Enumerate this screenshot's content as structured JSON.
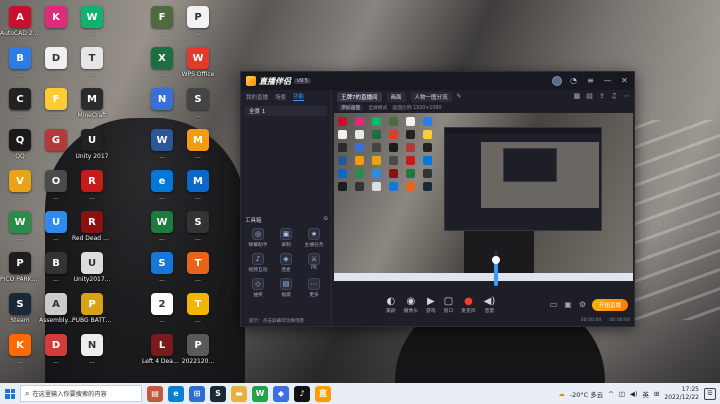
{
  "desktop_icons": [
    {
      "label": "AutoCAD 2014",
      "color": "#c8102e",
      "glyph": "A"
    },
    {
      "label": "...",
      "color": "#e02a7b",
      "glyph": "K"
    },
    {
      "label": "...",
      "color": "#10b36b",
      "glyph": "W"
    },
    {
      "label": "...",
      "color": "#4e6b3f",
      "glyph": "F"
    },
    {
      "label": "...",
      "color": "#f2f2f2",
      "glyph": "P"
    },
    {
      "label": "...",
      "color": "#2d7be5",
      "glyph": "B"
    },
    {
      "label": "...",
      "color": "#f0f0f0",
      "glyph": "D"
    },
    {
      "label": "...",
      "color": "#e6e6e6",
      "glyph": "T"
    },
    {
      "label": "...",
      "color": "#1d6f42",
      "glyph": "X"
    },
    {
      "label": "WPS Office",
      "color": "#e23a2c",
      "glyph": "W"
    },
    {
      "label": "...",
      "color": "#222222",
      "glyph": "C"
    },
    {
      "label": "...",
      "color": "#ffcc33",
      "glyph": "F"
    },
    {
      "label": "MineCraft",
      "color": "#2b2b2b",
      "glyph": "M"
    },
    {
      "label": "...",
      "color": "#3a6fd8",
      "glyph": "N"
    },
    {
      "label": "...",
      "color": "#444444",
      "glyph": "S"
    },
    {
      "label": "QQ",
      "color": "#1a1a1a",
      "glyph": "Q"
    },
    {
      "label": "...",
      "color": "#b33a3a",
      "glyph": "G"
    },
    {
      "label": "Unity 2017",
      "color": "#222222",
      "glyph": "U"
    },
    {
      "label": "...",
      "color": "#2b5797",
      "glyph": "W"
    },
    {
      "label": "...",
      "color": "#f39c12",
      "glyph": "M"
    },
    {
      "label": "...",
      "color": "#e8a317",
      "glyph": "V"
    },
    {
      "label": "...",
      "color": "#4a4a4a",
      "glyph": "O"
    },
    {
      "label": "...",
      "color": "#c61b1b",
      "glyph": "R"
    },
    {
      "label": "...",
      "color": "#0078d7",
      "glyph": "e"
    },
    {
      "label": "...",
      "color": "#0b68c9",
      "glyph": "M"
    },
    {
      "label": "...",
      "color": "#2a8c4a",
      "glyph": "W"
    },
    {
      "label": "...",
      "color": "#2d8ceb",
      "glyph": "U"
    },
    {
      "label": "Red Dead Redempti...",
      "color": "#8b1010",
      "glyph": "R"
    },
    {
      "label": "...",
      "color": "#1f7a3e",
      "glyph": "W"
    },
    {
      "label": "...",
      "color": "#333333",
      "glyph": "S"
    },
    {
      "label": "PICO PARKClass...",
      "color": "#1d1d1d",
      "glyph": "P"
    },
    {
      "label": "...",
      "color": "#333333",
      "glyph": "B"
    },
    {
      "label": "Unity2017...",
      "color": "#dddddd",
      "glyph": "U"
    },
    {
      "label": "...",
      "color": "#1677d8",
      "glyph": "S"
    },
    {
      "label": "...",
      "color": "#e8641b",
      "glyph": "T"
    },
    {
      "label": "Steam",
      "color": "#1b2838",
      "glyph": "S"
    },
    {
      "label": "Assembly...",
      "color": "#cccccc",
      "glyph": "A"
    },
    {
      "label": "PUBG BATTLEGR...",
      "color": "#d8a21b",
      "glyph": "P"
    },
    {
      "label": "...",
      "color": "#ffffff",
      "glyph": "2"
    },
    {
      "label": "...",
      "color": "#f2b600",
      "glyph": "T"
    },
    {
      "label": "...",
      "color": "#ff6a00",
      "glyph": "K"
    },
    {
      "label": "...",
      "color": "#d23b3b",
      "glyph": "D"
    },
    {
      "label": "...",
      "color": "#eeeeee",
      "glyph": "N"
    },
    {
      "label": "Left 4 Dead 2",
      "color": "#7a1a1a",
      "glyph": "L"
    },
    {
      "label": "2022120...",
      "color": "#5a5a5a",
      "glyph": "P"
    }
  ],
  "app": {
    "name": "直播伴侣",
    "version": "v9.5",
    "left_tabs": [
      "我的直播",
      "场景",
      "功能"
    ],
    "scene_item": "全景 1",
    "tools_title": "工具箱",
    "tools": [
      {
        "label": "弹幕助手",
        "glyph": "◎"
      },
      {
        "label": "录制",
        "glyph": "▣"
      },
      {
        "label": "主播任务",
        "glyph": "★"
      },
      {
        "label": "视频互动",
        "glyph": "♪"
      },
      {
        "label": "连麦",
        "glyph": "◈"
      },
      {
        "label": "PK",
        "glyph": "⚔"
      },
      {
        "label": "抽奖",
        "glyph": "◇"
      },
      {
        "label": "福袋",
        "glyph": "▤"
      },
      {
        "label": "更多",
        "glyph": "⋯"
      }
    ],
    "scene_tabs": [
      "王牌7的直播间",
      "画面",
      "人物一图分流"
    ],
    "sub_row": [
      "添加画面",
      "全屏模式",
      "画面比例 1920×1080"
    ],
    "controls": [
      {
        "label": "美颜",
        "glyph": "◐"
      },
      {
        "label": "摄像头",
        "glyph": "◉"
      },
      {
        "label": "游戏",
        "glyph": "▶"
      },
      {
        "label": "窗口",
        "glyph": "▢"
      },
      {
        "label": "麦克风",
        "glyph": "●"
      },
      {
        "label": "音量",
        "glyph": "◀)"
      }
    ],
    "go_live": "开始直播",
    "status_time": "00:00:00",
    "status_fps": "00:00:04",
    "status_left": "提示：点击屏幕可切换场景",
    "volume_level": 0.72
  },
  "taskbar": {
    "search_placeholder": "在这里输入你要搜索的内容",
    "weather": "-20°C 多云",
    "ime": "英",
    "time": "17:25",
    "date": "2022/12/22"
  }
}
